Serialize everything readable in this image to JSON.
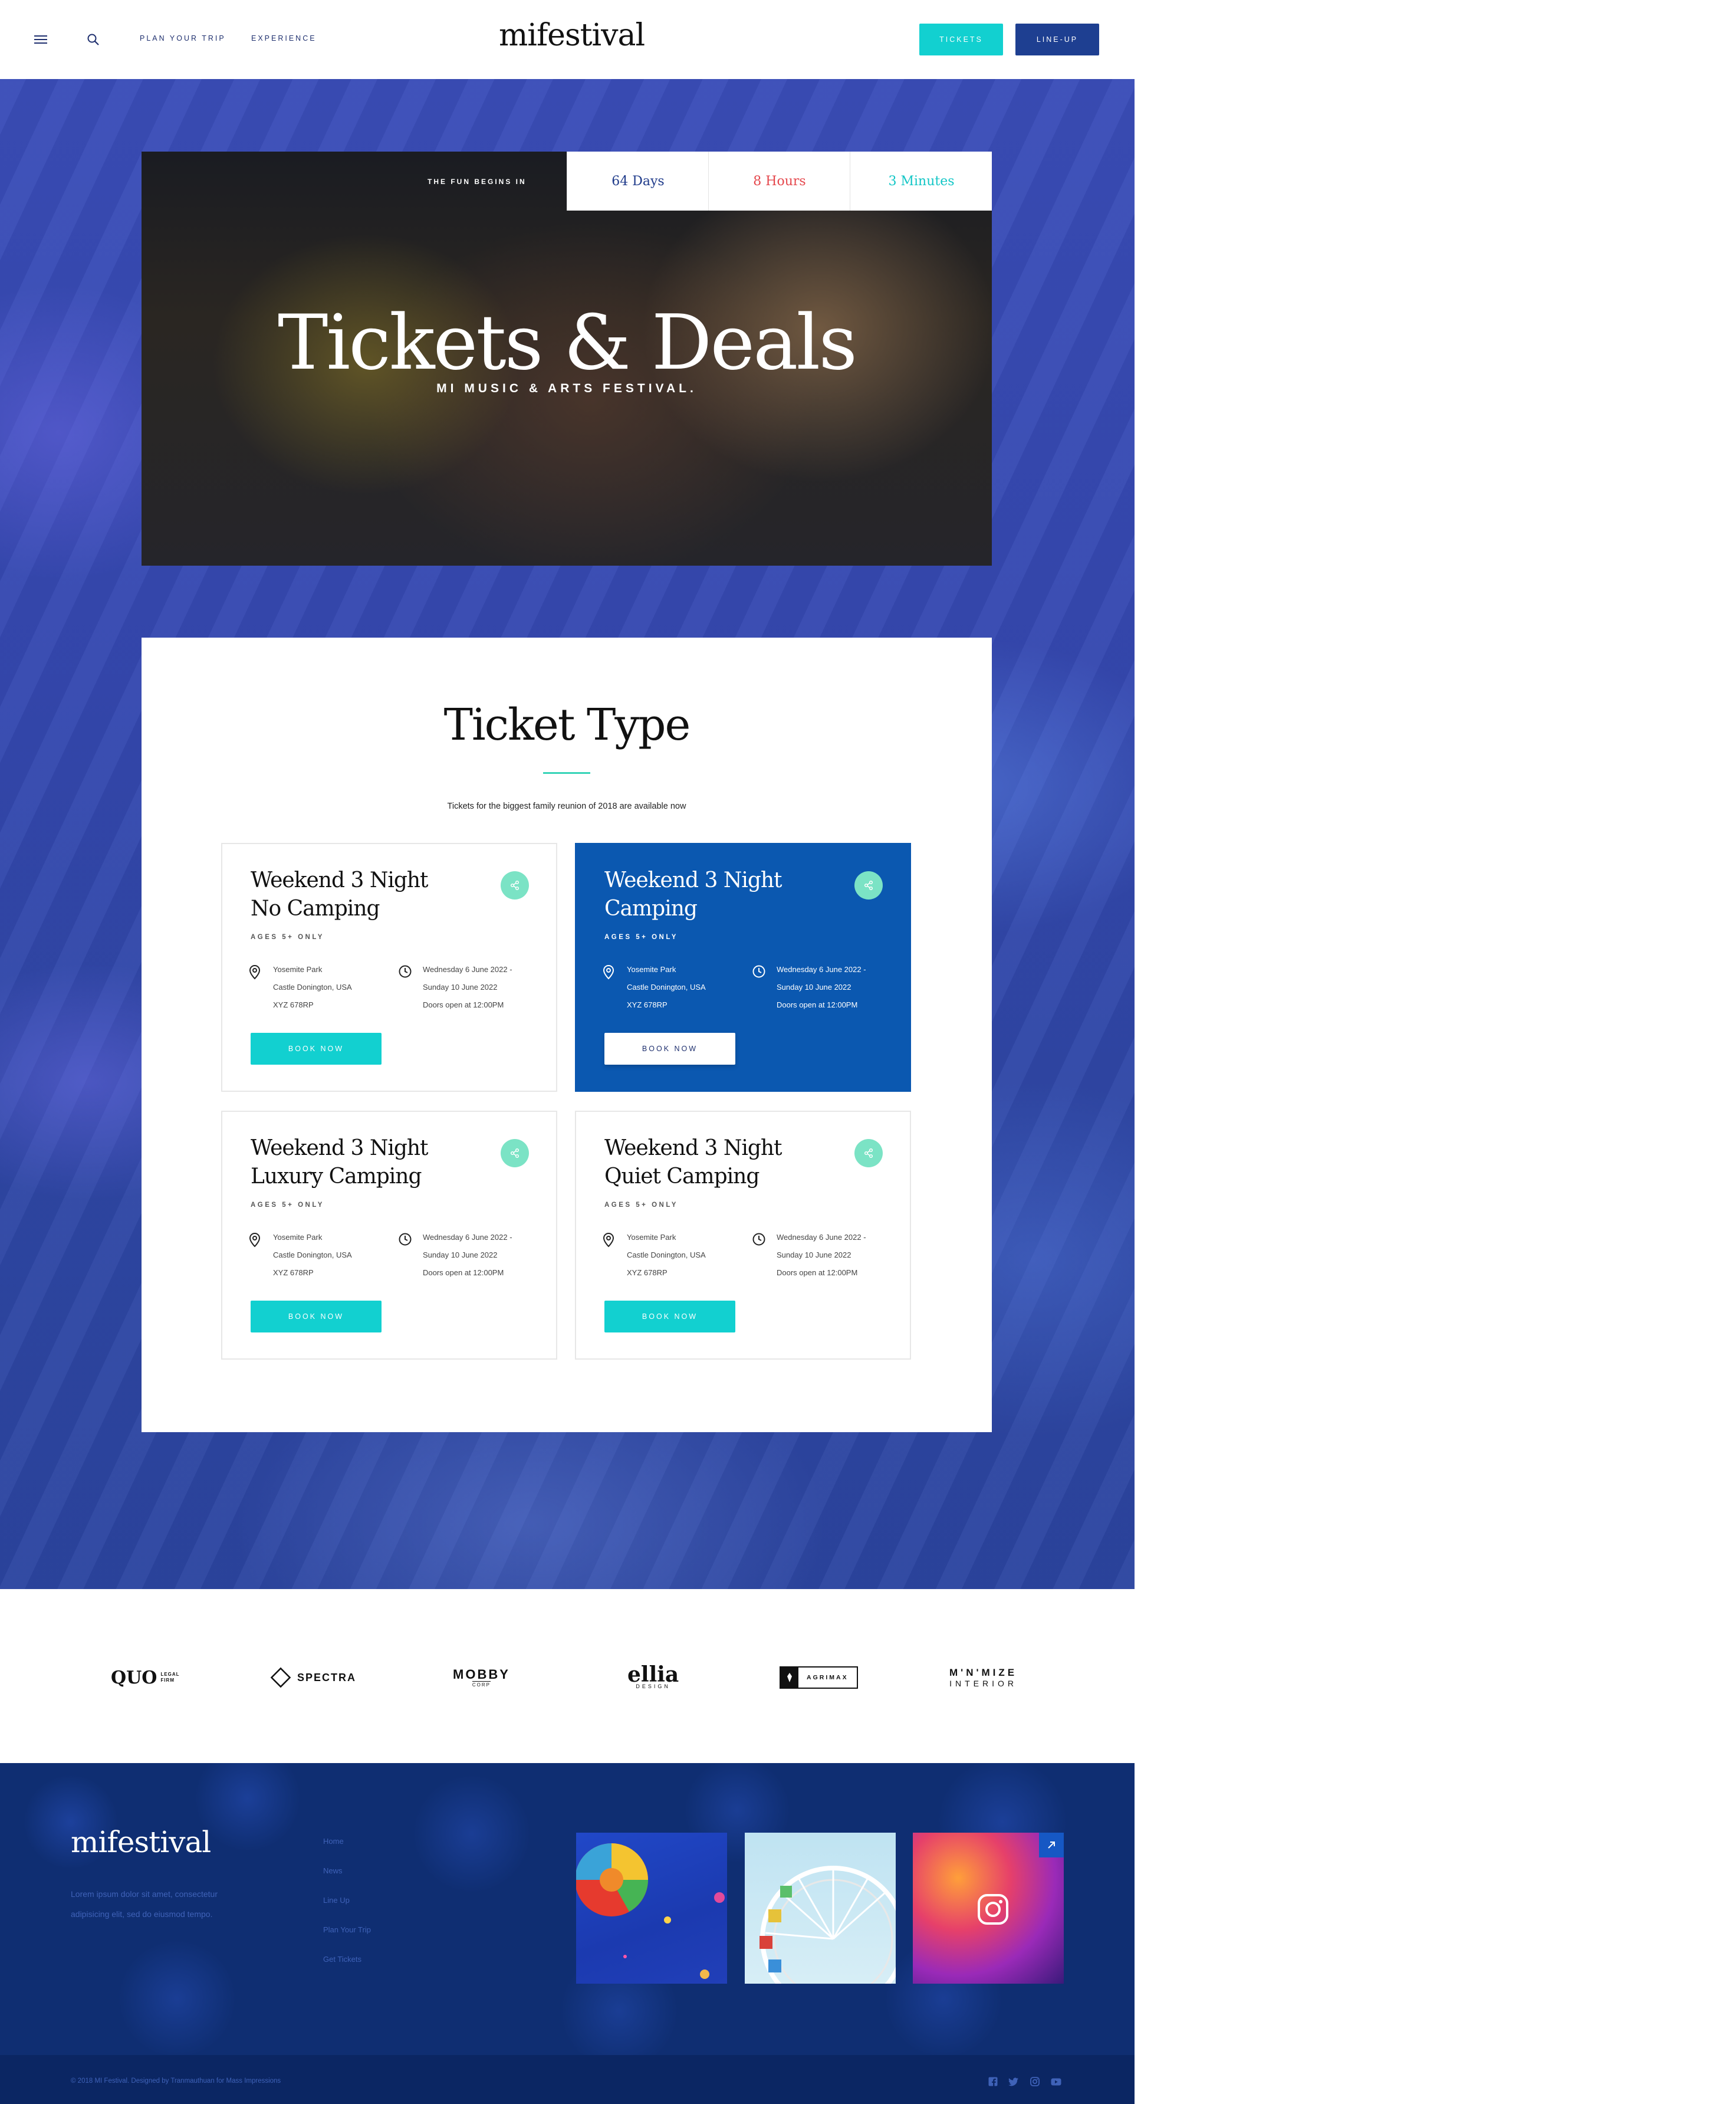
{
  "header": {
    "nav": [
      "PLAN YOUR TRIP",
      "EXPERIENCE"
    ],
    "logo": "mifestival",
    "tickets_button": "TICKETS",
    "lineup_button": "LINE-UP"
  },
  "hero": {
    "countdown_label": "THE FUN BEGINS IN",
    "countdown": [
      {
        "text": "64 Days",
        "color": "#1e3a8a"
      },
      {
        "text": "8 Hours",
        "color": "#e5484d"
      },
      {
        "text": "3 Minutes",
        "color": "#12c6c6"
      }
    ],
    "title": "Tickets & Deals",
    "subtitle": "MI MUSIC & ARTS FESTIVAL."
  },
  "tickets": {
    "title": "Ticket Type",
    "subtitle": "Tickets for the biggest family reunion of 2018 are available now",
    "cards": [
      {
        "title_line1": "Weekend 3 Night",
        "title_line2": "No Camping",
        "age": "AGES 5+ ONLY",
        "location": [
          "Yosemite Park",
          "Castle Donington, USA",
          "XYZ 678RP"
        ],
        "dates": [
          "Wednesday 6 June 2022 -",
          "Sunday 10 June 2022",
          "Doors open at 12:00PM"
        ],
        "button": "BOOK NOW",
        "active": false
      },
      {
        "title_line1": "Weekend 3 Night",
        "title_line2": "Camping",
        "age": "AGES 5+ ONLY",
        "location": [
          "Yosemite Park",
          "Castle Donington, USA",
          "XYZ 678RP"
        ],
        "dates": [
          "Wednesday 6 June 2022 -",
          "Sunday 10 June 2022",
          "Doors open at 12:00PM"
        ],
        "button": "BOOK NOW",
        "active": true
      },
      {
        "title_line1": "Weekend 3 Night",
        "title_line2": "Luxury Camping",
        "age": "AGES 5+ ONLY",
        "location": [
          "Yosemite Park",
          "Castle Donington, USA",
          "XYZ 678RP"
        ],
        "dates": [
          "Wednesday 6 June 2022 -",
          "Sunday 10 June 2022",
          "Doors open at 12:00PM"
        ],
        "button": "BOOK NOW",
        "active": false
      },
      {
        "title_line1": "Weekend 3 Night",
        "title_line2": "Quiet Camping",
        "age": "AGES 5+ ONLY",
        "location": [
          "Yosemite Park",
          "Castle Donington, USA",
          "XYZ 678RP"
        ],
        "dates": [
          "Wednesday 6 June 2022 -",
          "Sunday 10 June 2022",
          "Doors open at 12:00PM"
        ],
        "button": "BOOK NOW",
        "active": false
      }
    ]
  },
  "partners": [
    "QUO",
    "LEGAL FIRM",
    "SPECTRA",
    "MOBBY",
    "CORP",
    "ellia",
    "DESIGN",
    "AGRIMAX",
    "M'N'MIZE",
    "INTERIOR"
  ],
  "footer": {
    "logo": "mifestival",
    "text": "Lorem ipsum dolor sit amet, consectetur adipisicing elit, sed do eiusmod tempo.",
    "links": [
      "Home",
      "News",
      "Line Up",
      "Plan Your Trip",
      "Get Tickets"
    ],
    "copyright": "© 2018 MI Festival. Designed by Tranmauthuan for Mass Impressions"
  },
  "colors": {
    "accent_teal": "#12d0d0",
    "navy": "#1e3a8a",
    "active_card": "#0b58b0",
    "share_mint": "#7be3c5",
    "footer_bg": "#0f2e72"
  },
  "icons": [
    "menu-icon",
    "search-icon",
    "share-icon",
    "location-pin-icon",
    "clock-icon",
    "instagram-icon",
    "external-link-icon",
    "facebook-icon",
    "twitter-icon",
    "youtube-icon"
  ]
}
